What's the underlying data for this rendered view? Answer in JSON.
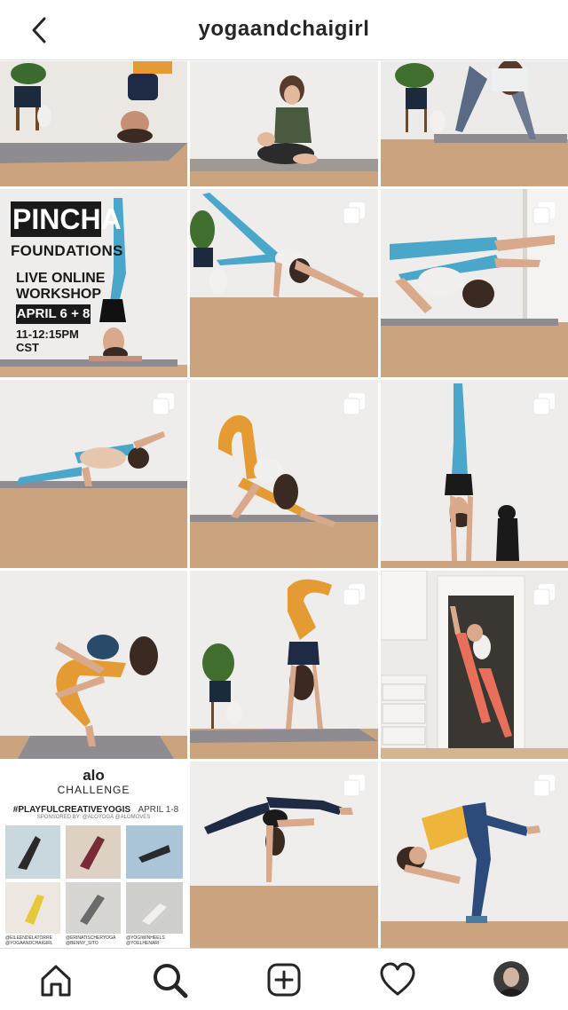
{
  "header": {
    "username": "yogaandchaigirl",
    "back_icon": "chevron-left-icon"
  },
  "grid": {
    "posts": [
      {
        "id": "r1c1",
        "multi": false
      },
      {
        "id": "r1c2",
        "multi": false
      },
      {
        "id": "r1c3",
        "multi": false
      },
      {
        "id": "r2c1",
        "multi": false
      },
      {
        "id": "r2c2",
        "multi": true
      },
      {
        "id": "r2c3",
        "multi": true
      },
      {
        "id": "r3c1",
        "multi": true
      },
      {
        "id": "r3c2",
        "multi": true
      },
      {
        "id": "r3c3",
        "multi": true
      },
      {
        "id": "r4c1",
        "multi": false
      },
      {
        "id": "r4c2",
        "multi": true
      },
      {
        "id": "r4c3",
        "multi": true
      },
      {
        "id": "r5c1",
        "multi": false
      },
      {
        "id": "r5c2",
        "multi": true
      },
      {
        "id": "r5c3",
        "multi": true
      }
    ]
  },
  "pincha_post": {
    "title": "PINCHA",
    "subtitle": "FOUNDATIONS",
    "line1": "LIVE ONLINE",
    "line2": "WORKSHOP",
    "dates": "APRIL 6 + 8",
    "time": "11-12:15PM CST"
  },
  "alo_post": {
    "brand": "alo",
    "label": "CHALLENGE",
    "hashtag": "#PLAYFULCREATIVEYOGIS",
    "dates": "APRIL 1-8",
    "sponsor": "SPONSORED BY: @ALOYOGA @ALOMOVES",
    "credits": [
      "@EILEENDELATORRE @YOGAANDCHAIGIRL",
      "@ERINATISCHERYOGA @BENNY_SITO",
      "@YOGIWINHEELS @YOELHENARI"
    ]
  },
  "tabbar": {
    "items": [
      "home-icon",
      "search-icon",
      "add-post-icon",
      "heart-icon",
      "profile-avatar"
    ]
  },
  "colors": {
    "wall": "#e9e6e2",
    "floor": "#caa47f",
    "mat": "#8d8c90",
    "teal": "#4aa7c9",
    "orange": "#e49b34",
    "navy": "#1f2a44",
    "border": "#dbdbdb"
  }
}
